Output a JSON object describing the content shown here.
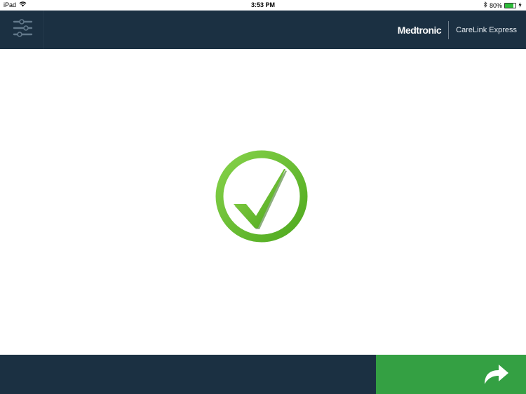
{
  "status_bar": {
    "device": "iPad",
    "time": "3:53 PM",
    "battery_percent": "80%",
    "battery_level": 0.8
  },
  "header": {
    "menu_icon": "sliders-icon",
    "brand_logo": "Medtronic",
    "product_name": "CareLink Express"
  },
  "main": {
    "status_icon": "success-checkmark-icon"
  },
  "footer": {
    "next_icon": "forward-arrow-icon"
  },
  "colors": {
    "header_bg": "#1b3042",
    "success_green": "#6cc23a",
    "button_green": "#34a043"
  }
}
